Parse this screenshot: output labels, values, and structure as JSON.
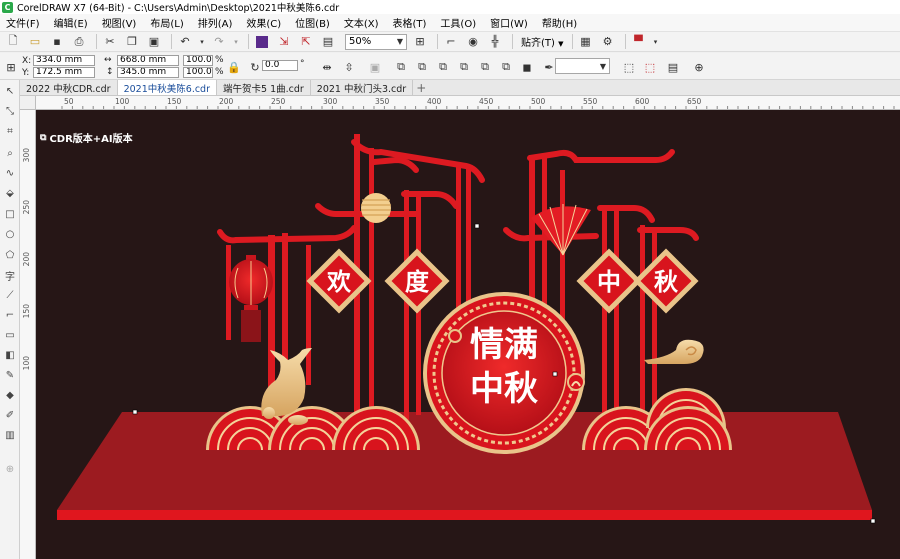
{
  "window": {
    "title": "CorelDRAW X7 (64-Bit) - C:\\Users\\Admin\\Desktop\\2021中秋美陈6.cdr"
  },
  "menu": [
    "文件(F)",
    "编辑(E)",
    "视图(V)",
    "布局(L)",
    "排列(A)",
    "效果(C)",
    "位图(B)",
    "文本(X)",
    "表格(T)",
    "工具(O)",
    "窗口(W)",
    "帮助(H)"
  ],
  "toolbar": {
    "zoom": "50%",
    "snap_label": "贴齐(T)"
  },
  "props": {
    "x_label": "X:",
    "x": "334.0 mm",
    "y_label": "Y:",
    "y": "172.5 mm",
    "w": "668.0 mm",
    "h": "345.0 mm",
    "sx": "100.0",
    "sy": "100.0",
    "pct": "%",
    "angle": "0.0",
    "deg": "°"
  },
  "tabs": [
    "2022 中秋CDR.cdr",
    "2021中秋美陈6.cdr",
    "端午贺卡5 1曲.cdr",
    "2021 中秋门头3.cdr"
  ],
  "active_tab": 1,
  "ruler": {
    "h": [
      "50",
      "100",
      "150",
      "200",
      "250",
      "300",
      "350",
      "400",
      "450",
      "500",
      "550",
      "600",
      "650"
    ],
    "v": [
      "300",
      "250",
      "200",
      "150",
      "100"
    ]
  },
  "canvas": {
    "version_note": "CDR版本+AI版本",
    "diamonds": [
      "欢",
      "度",
      "中",
      "秋"
    ],
    "medallion_line1": "情满",
    "medallion_line2": "中秋"
  },
  "colors": {
    "canvas_bg": "#261616",
    "red": "#d8141d",
    "gold": "#e9c48a",
    "platform": "#9c1b20"
  }
}
